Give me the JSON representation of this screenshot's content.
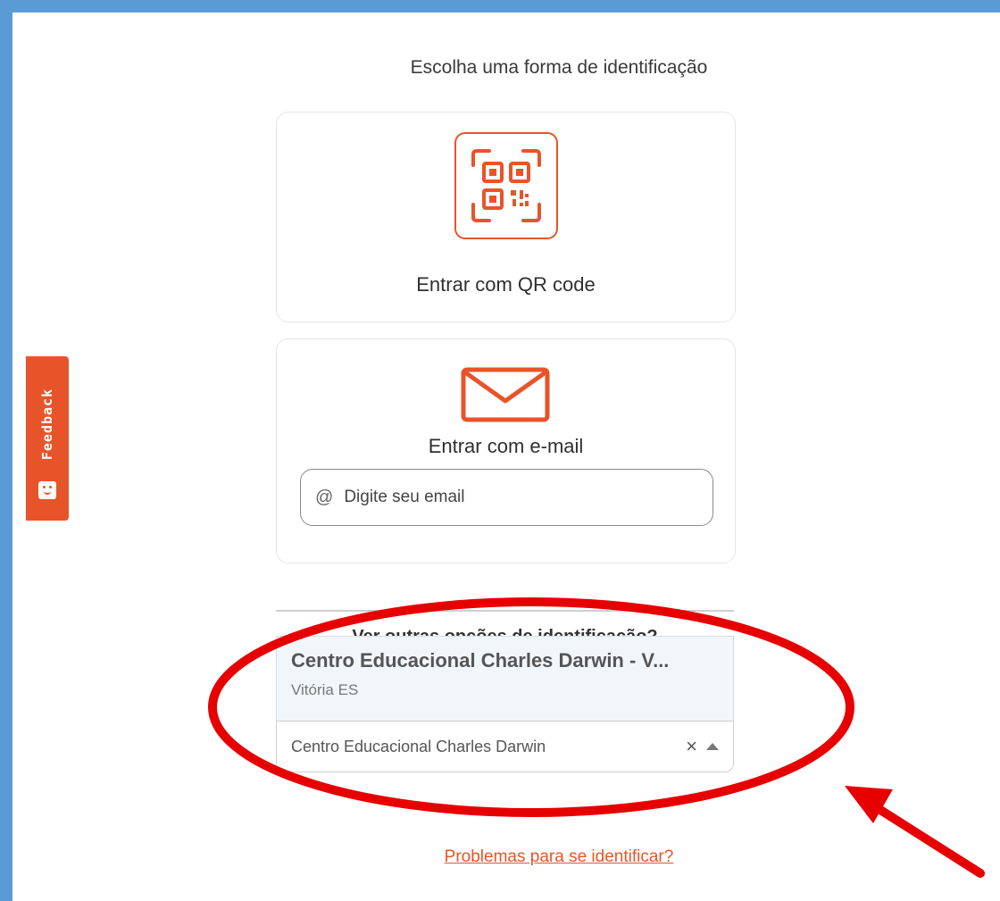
{
  "header": {
    "title": "Escolha uma forma de identificação"
  },
  "qr_card": {
    "label": "Entrar com QR code",
    "icon": "qr-code-icon"
  },
  "email_card": {
    "label": "Entrar com e-mail",
    "icon": "mail-icon",
    "input": {
      "placeholder": "Digite seu email",
      "value": "",
      "prefix": "@"
    }
  },
  "other_options": {
    "label": "Ver outras opções de identificação?"
  },
  "school_dropdown": {
    "option": {
      "title": "Centro Educacional Charles Darwin  -  V...",
      "subtitle": "Vitória ES"
    },
    "selected_value": "Centro Educacional Charles Darwin",
    "clear_label": "×"
  },
  "help_link": {
    "label": "Problemas para se identificar?"
  },
  "feedback": {
    "label": "Feedback"
  },
  "colors": {
    "accent": "#e8542a",
    "frame": "#5b9bd5",
    "annotation": "#e60000"
  }
}
